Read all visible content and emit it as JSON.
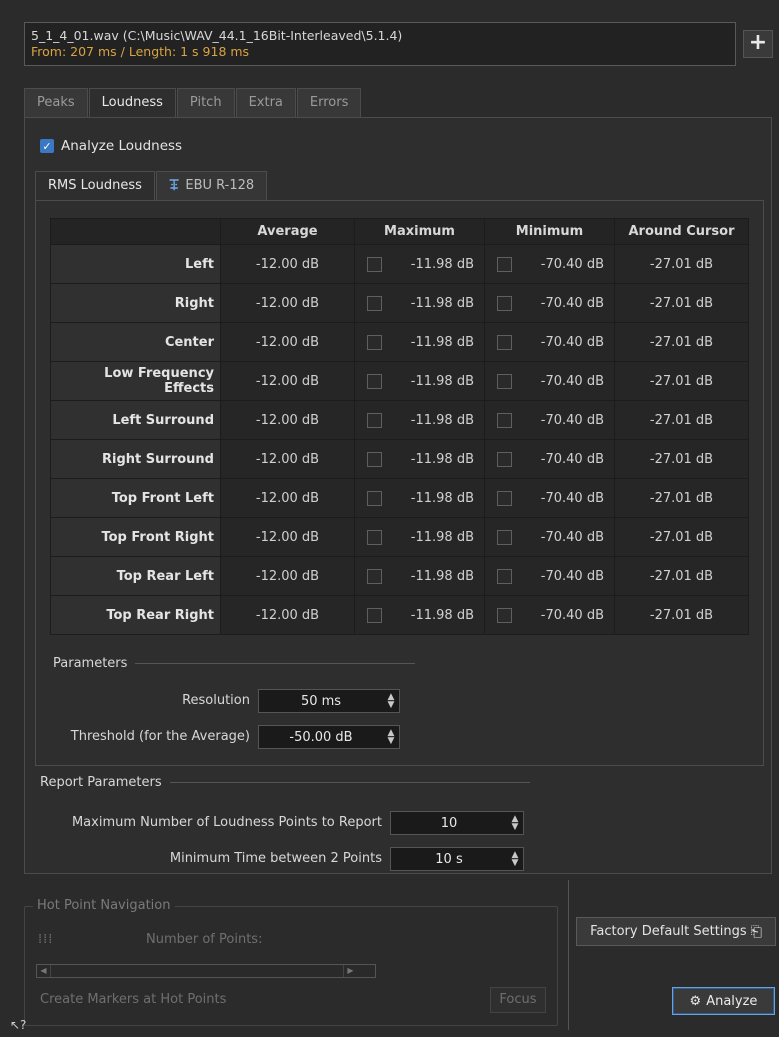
{
  "file": {
    "path": "5_1_4_01.wav (C:\\Music\\WAV_44.1_16Bit-Interleaved\\5.1.4)",
    "range": "From: 207 ms / Length: 1 s 918 ms",
    "add_label": "+"
  },
  "tabs": [
    {
      "label": "Peaks"
    },
    {
      "label": "Loudness",
      "active": true
    },
    {
      "label": "Pitch"
    },
    {
      "label": "Extra"
    },
    {
      "label": "Errors"
    }
  ],
  "analyze_loudness": {
    "label": "Analyze Loudness",
    "checked": true,
    "check_glyph": "✓"
  },
  "subtabs": [
    {
      "label": "RMS Loudness",
      "active": true
    },
    {
      "label": "EBU R-128",
      "icon": "ebu-icon",
      "icon_glyph": "ꔊ"
    }
  ],
  "table": {
    "headers": [
      "",
      "Average",
      "Maximum",
      "Minimum",
      "Around Cursor"
    ],
    "rows": [
      {
        "channel": "Left",
        "average": "-12.00 dB",
        "maximum": "-11.98 dB",
        "minimum": "-70.40 dB",
        "cursor": "-27.01 dB"
      },
      {
        "channel": "Right",
        "average": "-12.00 dB",
        "maximum": "-11.98 dB",
        "minimum": "-70.40 dB",
        "cursor": "-27.01 dB"
      },
      {
        "channel": "Center",
        "average": "-12.00 dB",
        "maximum": "-11.98 dB",
        "minimum": "-70.40 dB",
        "cursor": "-27.01 dB"
      },
      {
        "channel": "Low Frequency Effects",
        "average": "-12.00 dB",
        "maximum": "-11.98 dB",
        "minimum": "-70.40 dB",
        "cursor": "-27.01 dB"
      },
      {
        "channel": "Left Surround",
        "average": "-12.00 dB",
        "maximum": "-11.98 dB",
        "minimum": "-70.40 dB",
        "cursor": "-27.01 dB"
      },
      {
        "channel": "Right Surround",
        "average": "-12.00 dB",
        "maximum": "-11.98 dB",
        "minimum": "-70.40 dB",
        "cursor": "-27.01 dB"
      },
      {
        "channel": "Top Front Left",
        "average": "-12.00 dB",
        "maximum": "-11.98 dB",
        "minimum": "-70.40 dB",
        "cursor": "-27.01 dB"
      },
      {
        "channel": "Top Front Right",
        "average": "-12.00 dB",
        "maximum": "-11.98 dB",
        "minimum": "-70.40 dB",
        "cursor": "-27.01 dB"
      },
      {
        "channel": "Top Rear Left",
        "average": "-12.00 dB",
        "maximum": "-11.98 dB",
        "minimum": "-70.40 dB",
        "cursor": "-27.01 dB"
      },
      {
        "channel": "Top Rear Right",
        "average": "-12.00 dB",
        "maximum": "-11.98 dB",
        "minimum": "-70.40 dB",
        "cursor": "-27.01 dB"
      }
    ]
  },
  "parameters": {
    "title": "Parameters",
    "resolution_label": "Resolution",
    "resolution_value": "50 ms",
    "threshold_label": "Threshold (for the Average)",
    "threshold_value": "-50.00 dB"
  },
  "report": {
    "title": "Report Parameters",
    "max_points_label": "Maximum Number of Loudness Points to Report",
    "max_points_value": "10",
    "min_time_label": "Minimum Time between 2 Points",
    "min_time_value": "10 s"
  },
  "hot_point": {
    "title": "Hot Point Navigation",
    "points_label": "Number of Points:",
    "create_markers_label": "Create Markers at Hot Points",
    "focus_label": "Focus"
  },
  "buttons": {
    "factory_default": "Factory Default Settings",
    "analyze": "Analyze"
  },
  "glyphs": {
    "spin_arrows": "▲\n▼",
    "scroll_left": "◀",
    "scroll_right": "▶",
    "points_icon": "⁞⁞⁞",
    "factory_icon": "⎗",
    "analyze_icon": "⚙",
    "help_cursor": "↖?"
  },
  "colors": {
    "accent": "#3a78c3",
    "range_text": "#d9a441",
    "focus_ring": "#6aa2e0"
  }
}
